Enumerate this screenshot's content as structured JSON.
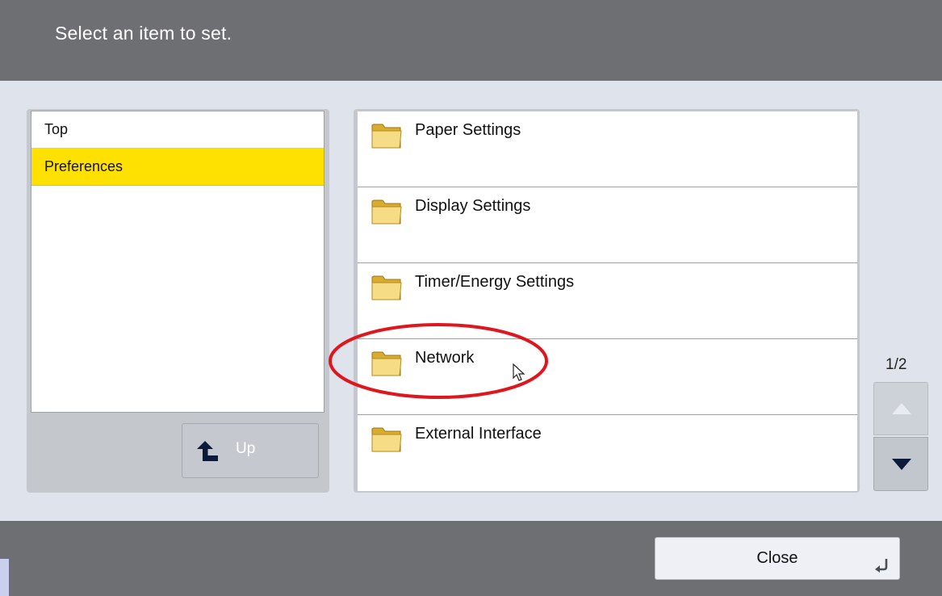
{
  "header": {
    "message": "Select an item to set."
  },
  "tree": {
    "items": [
      {
        "label": "Top",
        "selected": false
      },
      {
        "label": "Preferences",
        "selected": true
      }
    ],
    "up_label": "Up"
  },
  "list": {
    "items": [
      {
        "label": "Paper Settings",
        "icon": "folder-icon"
      },
      {
        "label": "Display Settings",
        "icon": "folder-icon"
      },
      {
        "label": "Timer/Energy Settings",
        "icon": "folder-icon"
      },
      {
        "label": "Network",
        "icon": "folder-icon",
        "annotated": true
      },
      {
        "label": "External Interface",
        "icon": "folder-icon"
      }
    ]
  },
  "pagination": {
    "label": "1/2",
    "current": 1,
    "total": 2
  },
  "footer": {
    "close_label": "Close"
  },
  "colors": {
    "highlight": "#ffe100",
    "annotation": "#e0161e",
    "bar": "#6e6f72"
  }
}
